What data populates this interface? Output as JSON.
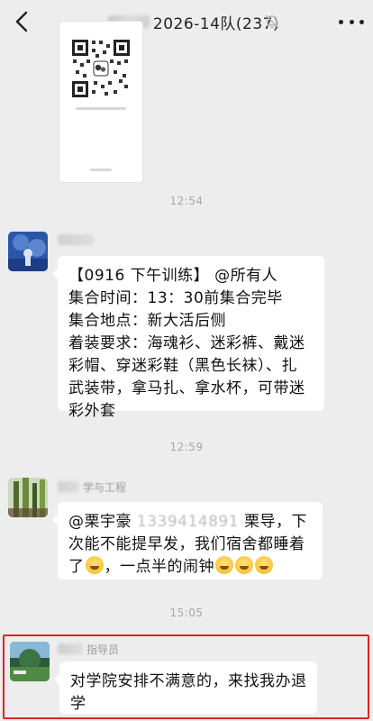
{
  "header": {
    "title": "2026-14队(237)",
    "back_icon": "chevron-left-icon",
    "mute_icon": "bell-off-icon",
    "more_icon": "more-dots-icon"
  },
  "messages": {
    "time1": "12:54",
    "msg1": {
      "lines": [
        "【0916 下午训练】 @所有人",
        "集合时间：13：30前集合完毕",
        "集合地点：新大活后侧",
        "着装要求：海魂衫、迷彩裤、戴迷",
        "彩帽、穿迷彩鞋（黑色长袜）、扎",
        "武装带，拿马扎、拿水杯，可带迷",
        "彩外套"
      ]
    },
    "time2": "12:59",
    "msg2": {
      "sender": "学与工程",
      "line1_a": "@栗宇豪",
      "line1_phone": "1339414891",
      "line1_b": " 栗导，下",
      "line2": "次能不能提早发，我们宿舍都睡着",
      "line3_a": "了",
      "line3_b": "，一点半的闹钟"
    },
    "time3": "15:05",
    "msg3": {
      "sender": "指导员",
      "lines": [
        "对学院安排不满意的，来找我办退",
        "学"
      ]
    }
  },
  "colors": {
    "background": "#ededed",
    "bubble": "#ffffff",
    "highlight": "#d42a24"
  }
}
